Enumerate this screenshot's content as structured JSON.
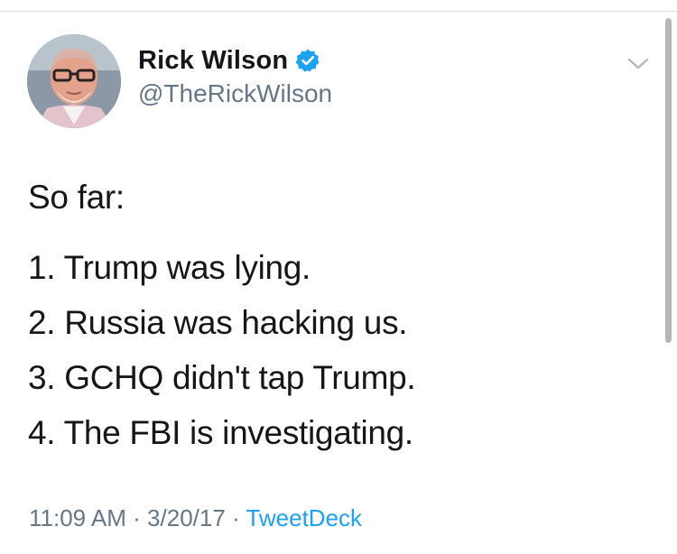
{
  "tweet": {
    "author": {
      "display_name": "Rick Wilson",
      "handle": "@TheRickWilson",
      "verified": true,
      "avatar_icon": "profile-photo"
    },
    "menu_icon": "chevron-down-icon",
    "body": {
      "intro": "So far:",
      "lines": [
        "1. Trump was lying.",
        "2. Russia was hacking us.",
        "3. GCHQ didn't tap Trump.",
        "4. The FBI is investigating."
      ]
    },
    "meta": {
      "time": "11:09 AM",
      "separator1": " · ",
      "date": "3/20/17",
      "separator2": " · ",
      "source": "TweetDeck"
    }
  },
  "colors": {
    "text_primary": "#14171a",
    "text_secondary": "#657786",
    "link": "#1da1f2",
    "verified_badge": "#1da1f2",
    "divider": "#d9dde1"
  }
}
